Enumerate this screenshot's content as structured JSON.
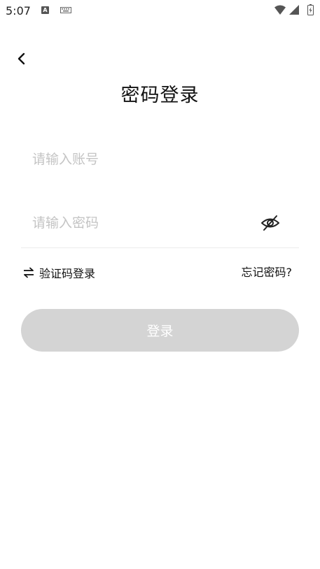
{
  "status_bar": {
    "time": "5:07",
    "icons": [
      "a-notification-icon",
      "keyboard-icon",
      "wifi-icon",
      "signal-icon",
      "battery-icon"
    ]
  },
  "header": {
    "back_icon": "chevron-left-icon",
    "title": "密码登录"
  },
  "form": {
    "account_placeholder": "请输入账号",
    "account_value": "",
    "password_placeholder": "请输入密码",
    "password_value": "",
    "password_visibility_icon": "eye-off-icon"
  },
  "links": {
    "sms_login_icon": "switch-arrows-icon",
    "sms_login_label": "验证码登录",
    "forgot_password_label": "忘记密码?"
  },
  "actions": {
    "login_label": "登录"
  },
  "colors": {
    "login_button_disabled": "#d4d4d4",
    "placeholder": "#c4c4c4",
    "divider": "#ececec",
    "text": "#111111"
  }
}
